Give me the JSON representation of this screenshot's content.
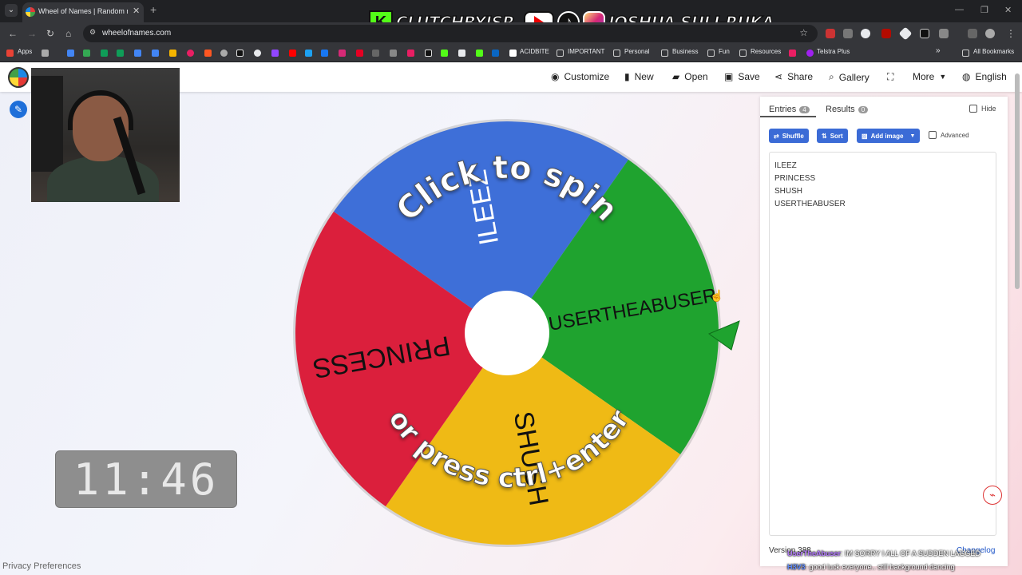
{
  "browser": {
    "tab_title": "Wheel of Names | Random nam",
    "url": "wheelofnames.com",
    "bookmarks": [
      "Apps",
      "ACIDBITE",
      "IMPORTANT",
      "Personal",
      "Business",
      "Fun",
      "Resources",
      "Telstra Plus",
      "All Bookmarks"
    ]
  },
  "overlay": {
    "kick_name": "CLUTCHBYJSR",
    "social_name": "JOSHUA SULI-RUKA",
    "clock": "11:46",
    "chat": [
      {
        "user": "UserTheAbuser",
        "text": ": IM SORRY I ALL OF A SUDDEN LAGGED"
      },
      {
        "user": "H3V3",
        "text": ": good luck everyone.. still background dancing"
      }
    ]
  },
  "toolbar": {
    "customize": "Customize",
    "new": "New",
    "open": "Open",
    "save": "Save",
    "share": "Share",
    "gallery": "Gallery",
    "more": "More",
    "language": "English"
  },
  "wheel": {
    "segments": [
      {
        "label": "ILEEZ",
        "color": "#3e6fd8"
      },
      {
        "label": "USERTHEABUSER",
        "color": "#1fa32f"
      },
      {
        "label": "SHUSH",
        "color": "#efba15"
      },
      {
        "label": "PRINCESS",
        "color": "#db1f3c"
      }
    ],
    "spin_text_top": "Click to spin",
    "spin_text_bottom": "or press ctrl+enter"
  },
  "panel": {
    "tab_entries": "Entries",
    "entries_count": "4",
    "tab_results": "Results",
    "results_count": "0",
    "hide_label": "Hide",
    "shuffle": "Shuffle",
    "sort": "Sort",
    "add_image": "Add image",
    "advanced": "Advanced",
    "entries": [
      "ILEEZ",
      "PRINCESS",
      "SHUSH",
      "USERTHEABUSER"
    ],
    "version": "Version 388",
    "changelog": "Changelog"
  },
  "footer": {
    "privacy": "Privacy Preferences"
  }
}
